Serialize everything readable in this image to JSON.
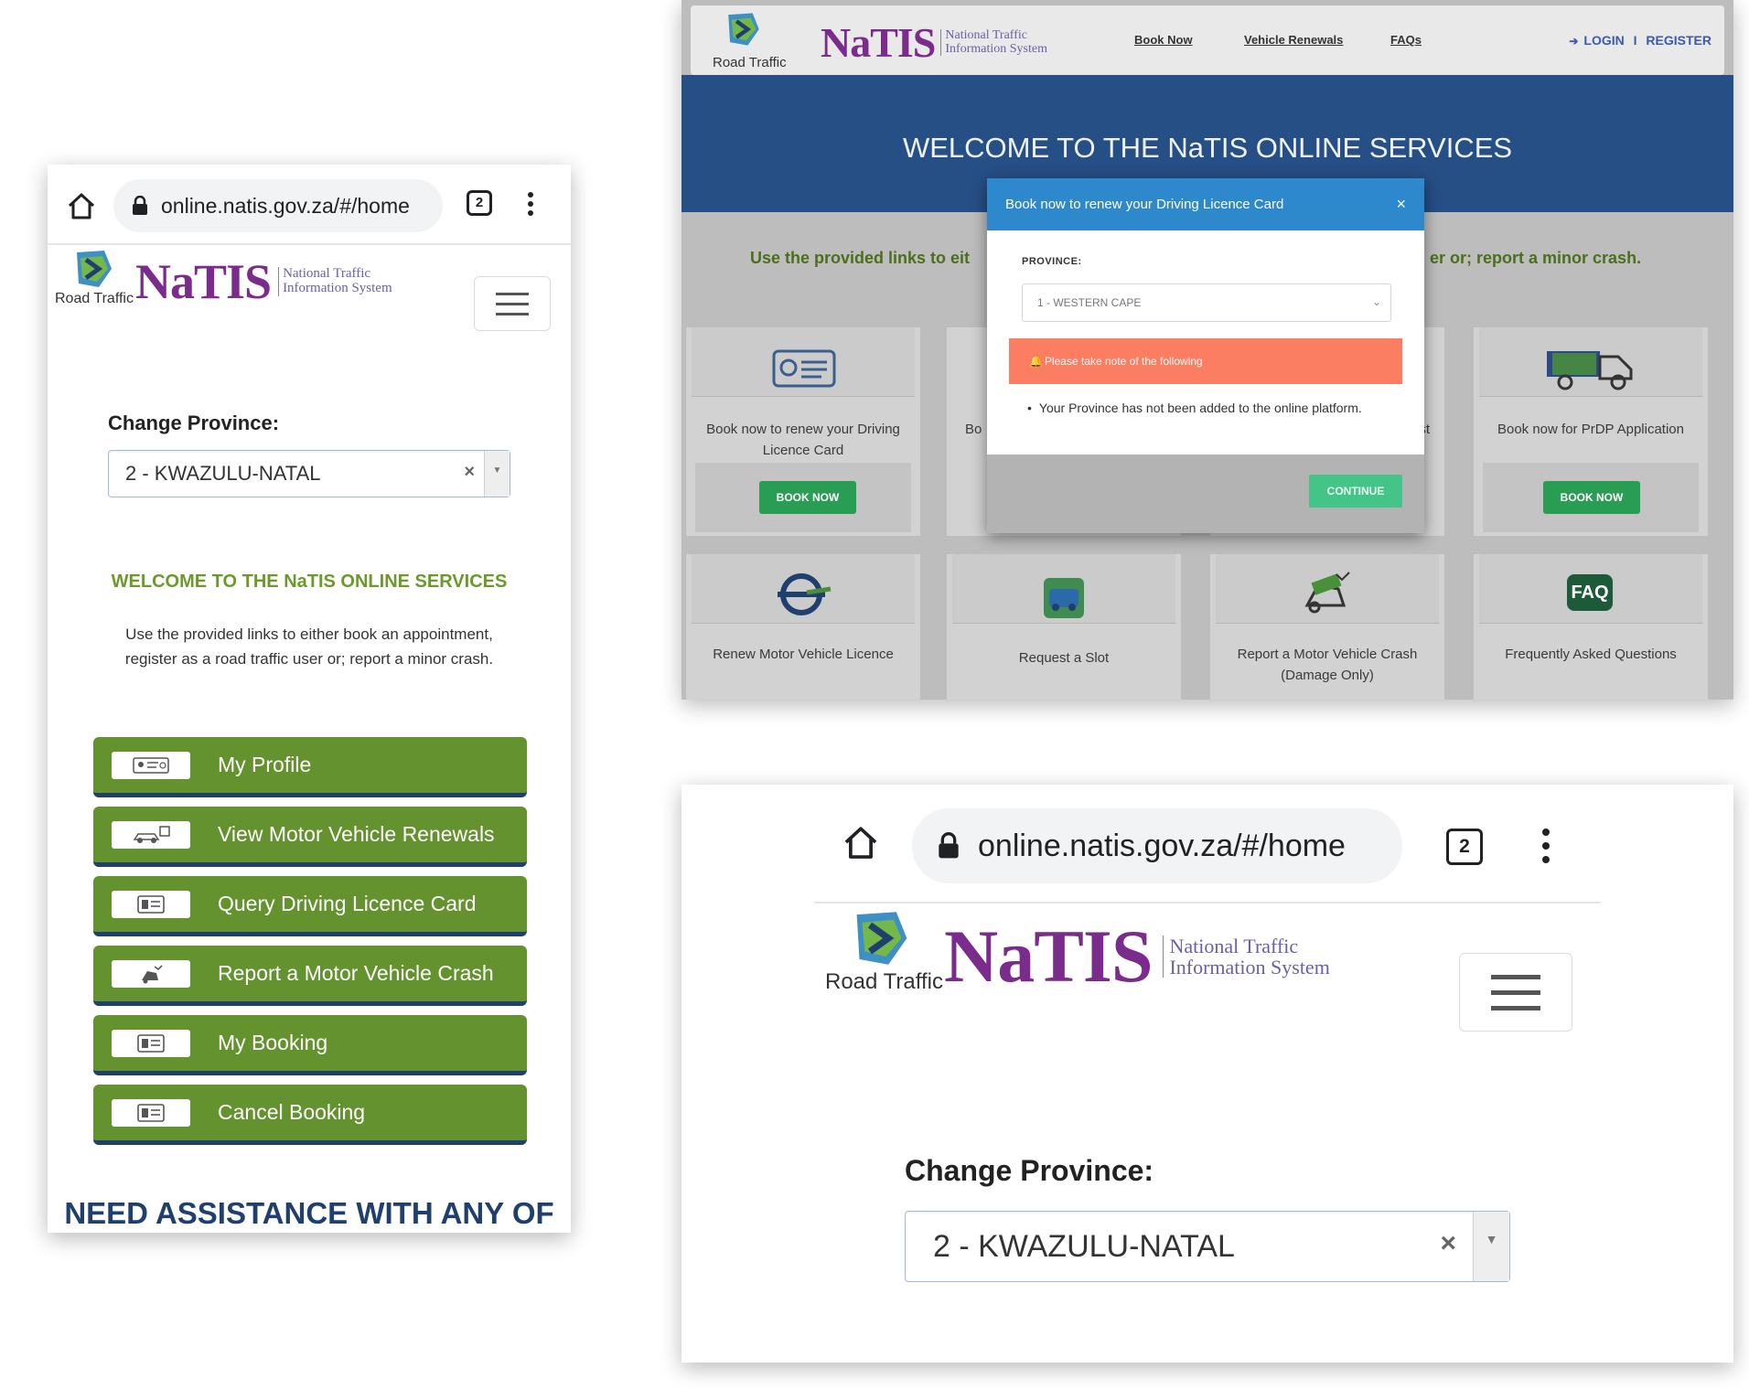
{
  "mobile": {
    "browser": {
      "url": "online.natis.gov.za/#/home",
      "tab_count": "2"
    },
    "logo": {
      "rt_label": "Road Traffic",
      "wordmark": "NaTIS",
      "sub_line1": "National Traffic",
      "sub_line2": "Information System"
    },
    "change_province_label": "Change Province:",
    "province_value": "2 - KWAZULU-NATAL",
    "clear_symbol": "×",
    "welcome": "WELCOME TO THE NaTIS ONLINE SERVICES",
    "intro": "Use the provided links to either book an appointment, register as a road traffic user or; report a minor crash.",
    "menu": [
      {
        "label": "My Profile",
        "icon": "profile-card-icon"
      },
      {
        "label": "View Motor Vehicle Renewals",
        "icon": "car-renewal-icon"
      },
      {
        "label": "Query Driving Licence Card",
        "icon": "licence-card-icon"
      },
      {
        "label": "Report a Motor Vehicle Crash",
        "icon": "crash-icon"
      },
      {
        "label": "My Booking",
        "icon": "booking-card-icon"
      },
      {
        "label": "Cancel Booking",
        "icon": "cancel-card-icon"
      }
    ],
    "need_assistance": "NEED ASSISTANCE WITH ANY OF"
  },
  "desktop": {
    "logo": {
      "rt_label": "Road Traffic",
      "wordmark": "NaTIS",
      "sub_line1": "National Traffic",
      "sub_line2": "Information System"
    },
    "nav": {
      "book_now": "Book Now",
      "vehicle_renewals": "Vehicle Renewals",
      "faqs": "FAQs",
      "login": "LOGIN",
      "sep": "I",
      "register": "REGISTER"
    },
    "banner_title": "WELCOME TO THE NaTIS ONLINE SERVICES",
    "provided_left": "Use the provided links to eit",
    "provided_right": "er or; report a minor crash.",
    "cards": {
      "c1": "Book now to renew your Driving Licence Card",
      "c2_partial": "Bo",
      "c3_partial": "st",
      "c4": "Book now for PrDP Application",
      "book_now_btn": "BOOK NOW",
      "r2c1": "Renew Motor Vehicle Licence",
      "r2c2": "Request a Slot",
      "r2c3": "Report a Motor Vehicle Crash (Damage Only)",
      "r2c4": "Frequently Asked Questions",
      "faq_badge": "FAQ"
    },
    "modal": {
      "title": "Book now to renew your Driving Licence Card",
      "close": "×",
      "province_label": "PROVINCE:",
      "province_value": "1 - WESTERN CAPE",
      "alert": "Please take note of the following",
      "bullet": "Your Province has not been added to the online platform.",
      "continue": "CONTINUE"
    }
  },
  "zoom": {
    "browser": {
      "url": "online.natis.gov.za/#/home",
      "tab_count": "2"
    },
    "logo": {
      "rt_label": "Road Traffic",
      "wordmark": "NaTIS",
      "sub_line1": "National Traffic",
      "sub_line2": "Information System"
    },
    "change_province_label": "Change Province:",
    "province_value": "2 - KWAZULU-NATAL",
    "clear_symbol": "×"
  },
  "colors": {
    "green_button": "#63922f",
    "navy": "#1f3f6e",
    "banner": "#264f86",
    "modal_header": "#2e88cc",
    "alert": "#fb7d62",
    "continue": "#44c489",
    "natis_purple": "#7a2b8c"
  }
}
